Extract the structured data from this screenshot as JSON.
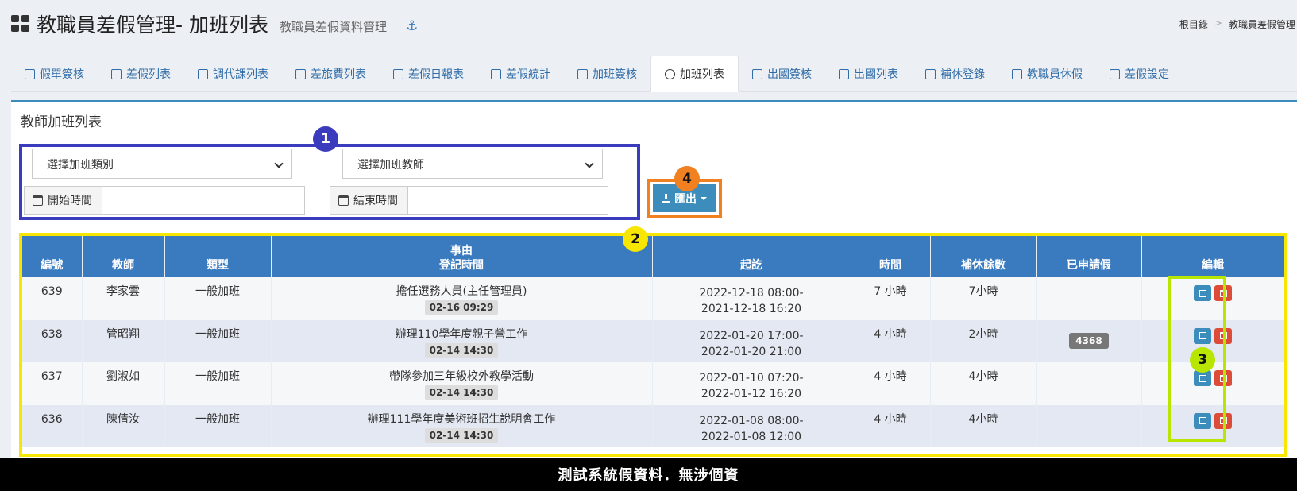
{
  "header": {
    "title": "教職員差假管理- 加班列表",
    "subtitle": "教職員差假資料管理",
    "anchor_icon": "anchor-icon"
  },
  "breadcrumb": [
    "根目錄",
    "教職員差假管理"
  ],
  "tabs": [
    {
      "label": "假單簽核",
      "icon": "hourglass-icon"
    },
    {
      "label": "差假列表",
      "icon": "list-icon"
    },
    {
      "label": "調代課列表",
      "icon": "table-icon"
    },
    {
      "label": "差旅費列表",
      "icon": "bar-chart-icon"
    },
    {
      "label": "差假日報表",
      "icon": "pie-chart-icon"
    },
    {
      "label": "差假統計",
      "icon": "calculator-icon"
    },
    {
      "label": "加班簽核",
      "icon": "file-icon"
    },
    {
      "label": "加班列表",
      "icon": "clock-icon",
      "active": true
    },
    {
      "label": "出國簽核",
      "icon": "file-icon"
    },
    {
      "label": "出國列表",
      "icon": "file-icon"
    },
    {
      "label": "補休登錄",
      "icon": "battery-icon"
    },
    {
      "label": "教職員休假",
      "icon": "sliders-icon"
    },
    {
      "label": "差假設定",
      "icon": "gears-icon"
    }
  ],
  "panel": {
    "title": "教師加班列表",
    "type_select": "選擇加班類別",
    "teacher_select": "選擇加班教師",
    "start_label": "開始時間",
    "end_label": "結束時間",
    "export_label": "匯出"
  },
  "annotations": [
    "1",
    "2",
    "3",
    "4"
  ],
  "table": {
    "headers": {
      "no": "編號",
      "teacher": "教師",
      "type": "類型",
      "reason_line1": "事由",
      "reason_line2": "登記時間",
      "period": "起訖",
      "hours": "時間",
      "remaining": "補休餘數",
      "applied": "已申請假",
      "edit": "編輯"
    },
    "rows": [
      {
        "no": "639",
        "teacher": "李家雲",
        "type": "一般加班",
        "reason": "擔任選務人員(主任管理員)",
        "reg_time": "02-16 09:29",
        "start": "2022-12-18 08:00-",
        "end": "2021-12-18 16:20",
        "hours": "7 小時",
        "remaining": "7小時",
        "applied": ""
      },
      {
        "no": "638",
        "teacher": "管昭翔",
        "type": "一般加班",
        "reason": "辦理110學年度親子營工作",
        "reg_time": "02-14 14:30",
        "start": "2022-01-20 17:00-",
        "end": "2022-01-20 21:00",
        "hours": "4 小時",
        "remaining": "2小時",
        "applied": "4368"
      },
      {
        "no": "637",
        "teacher": "劉淑如",
        "type": "一般加班",
        "reason": "帶隊參加三年級校外教學活動",
        "reg_time": "02-14 14:30",
        "start": "2022-01-10 07:20-",
        "end": "2022-01-12 16:20",
        "hours": "4 小時",
        "remaining": "4小時",
        "applied": ""
      },
      {
        "no": "636",
        "teacher": "陳倩汝",
        "type": "一般加班",
        "reason": "辦理111學年度美術班招生說明會工作",
        "reg_time": "02-14 14:30",
        "start": "2022-01-08 08:00-",
        "end": "2022-01-08 12:00",
        "hours": "4 小時",
        "remaining": "4小時",
        "applied": ""
      }
    ]
  },
  "footer": "測試系統假資料．無涉個資"
}
